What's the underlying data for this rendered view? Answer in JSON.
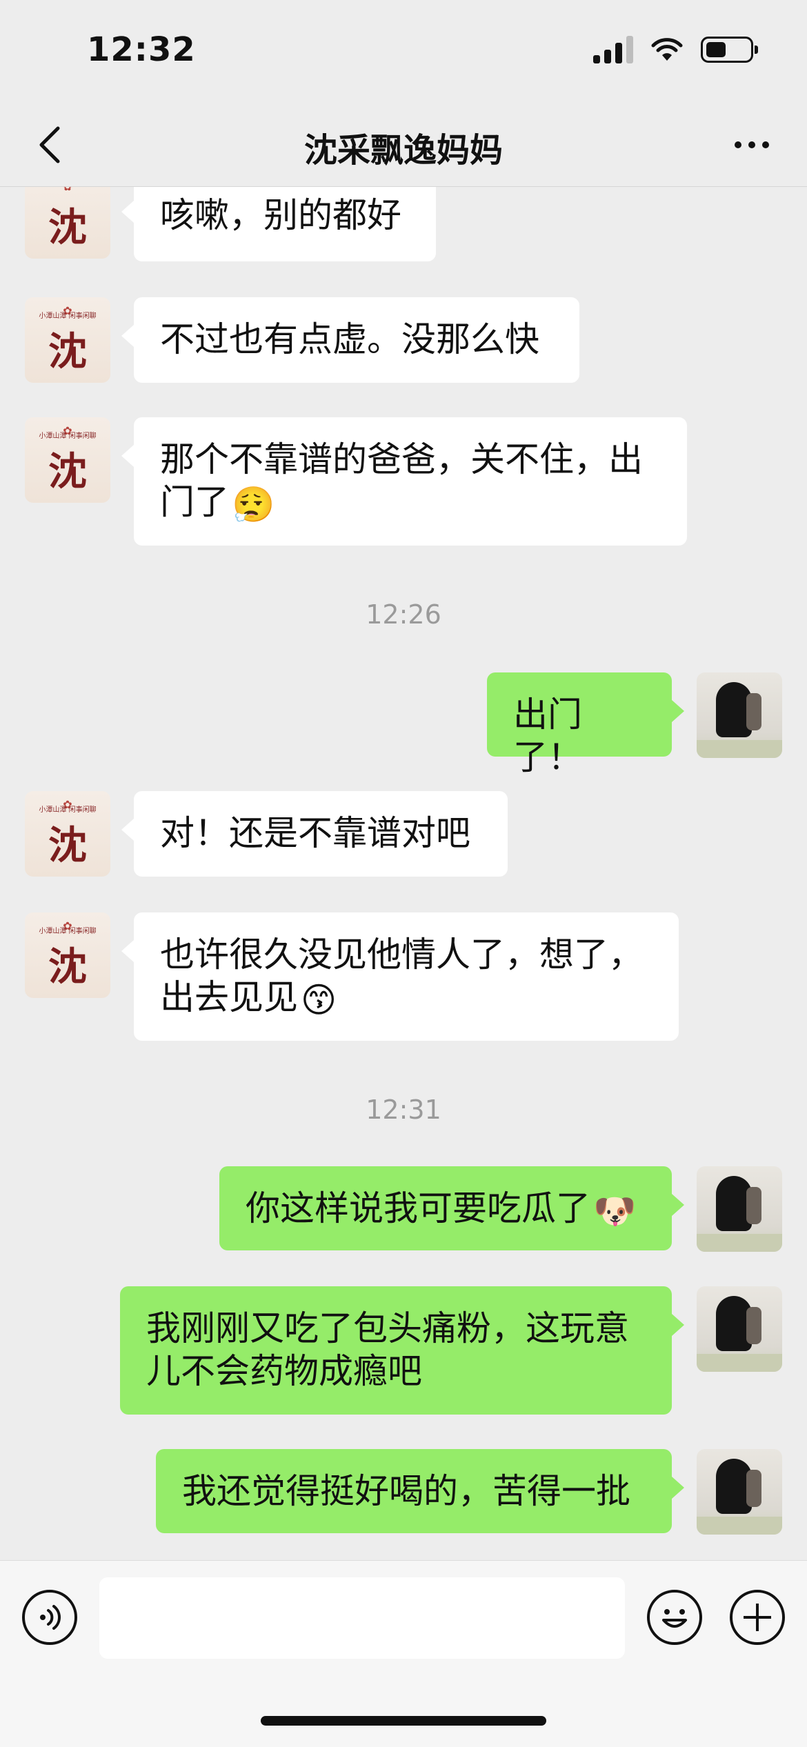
{
  "status_bar": {
    "time": "12:32"
  },
  "header": {
    "title": "沈采飘逸妈妈"
  },
  "avatars": {
    "contact_char": "沈",
    "contact_crest": "✿",
    "contact_tagline": "小潭山潭 闲事闲聊"
  },
  "messages": [
    {
      "side": "them",
      "text": "咳嗽，别的都好"
    },
    {
      "side": "them",
      "text": "不过也有点虚。没那么快"
    },
    {
      "side": "them",
      "text": "那个不靠谱的爸爸，关不住，出门了",
      "emoji": "😮‍💨"
    },
    {
      "type": "time",
      "text": "12:26"
    },
    {
      "side": "me",
      "text": "出门了！"
    },
    {
      "side": "them",
      "text": "对！还是不靠谱对吧"
    },
    {
      "side": "them",
      "text": "也许很久没见他情人了，想了，出去见见",
      "emoji": "😙"
    },
    {
      "type": "time",
      "text": "12:31"
    },
    {
      "side": "me",
      "text": "你这样说我可要吃瓜了",
      "emoji": "🐶"
    },
    {
      "side": "me",
      "text": "我刚刚又吃了包头痛粉，这玩意儿不会药物成瘾吧"
    },
    {
      "side": "me",
      "text": "我还觉得挺好喝的，苦得一批"
    }
  ],
  "input": {
    "placeholder": ""
  },
  "colors": {
    "me_bubble": "#95ec69",
    "them_bubble": "#ffffff",
    "background": "#ededed"
  }
}
